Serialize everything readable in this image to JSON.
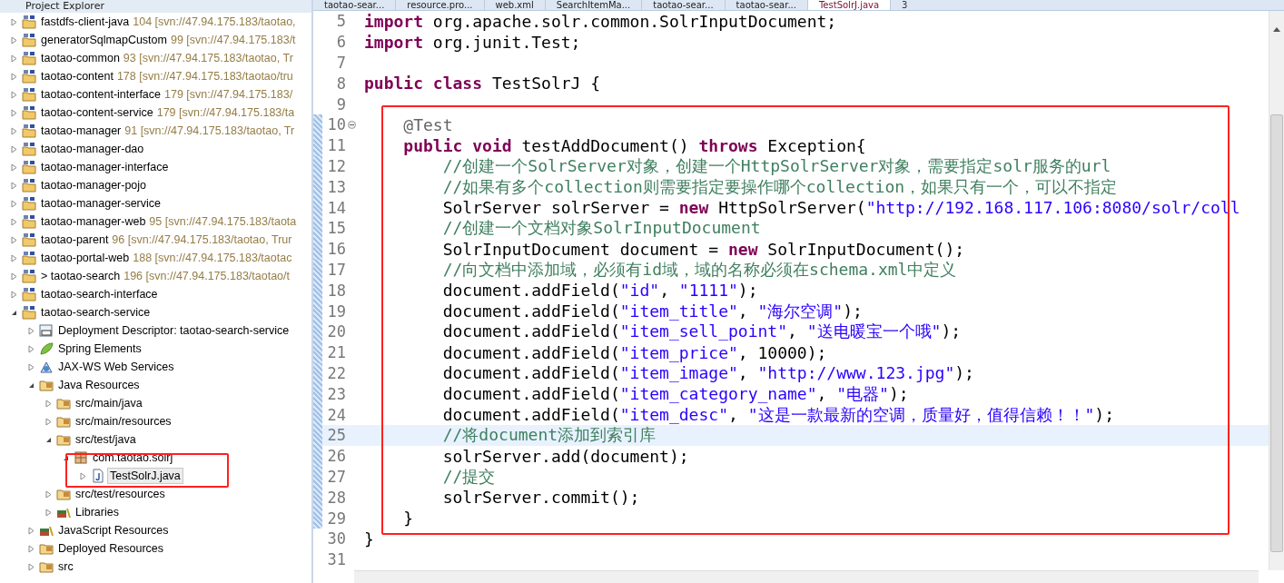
{
  "explorer": {
    "title": "Project Explorer",
    "tree": [
      {
        "label": "fastdfs-client-java",
        "decoration": "104 [svn://47.94.175.183/taotao,",
        "kind": "project",
        "expanded": false
      },
      {
        "label": "generatorSqlmapCustom",
        "decoration": "99 [svn://47.94.175.183/t",
        "kind": "project",
        "expanded": false
      },
      {
        "label": "taotao-common",
        "decoration": "93 [svn://47.94.175.183/taotao, Tr",
        "kind": "project",
        "expanded": false
      },
      {
        "label": "taotao-content",
        "decoration": "178 [svn://47.94.175.183/taotao/tru",
        "kind": "project",
        "expanded": false
      },
      {
        "label": "taotao-content-interface",
        "decoration": "179 [svn://47.94.175.183/",
        "kind": "project",
        "expanded": false
      },
      {
        "label": "taotao-content-service",
        "decoration": "179 [svn://47.94.175.183/ta",
        "kind": "project",
        "expanded": false
      },
      {
        "label": "taotao-manager",
        "decoration": "91 [svn://47.94.175.183/taotao, Tr",
        "kind": "project",
        "expanded": false
      },
      {
        "label": "taotao-manager-dao",
        "kind": "project",
        "expanded": false
      },
      {
        "label": "taotao-manager-interface",
        "kind": "project",
        "expanded": false
      },
      {
        "label": "taotao-manager-pojo",
        "kind": "project",
        "expanded": false
      },
      {
        "label": "taotao-manager-service",
        "kind": "project",
        "expanded": false
      },
      {
        "label": "taotao-manager-web",
        "decoration": "95 [svn://47.94.175.183/taota",
        "kind": "project",
        "expanded": false
      },
      {
        "label": "taotao-parent",
        "decoration": "96 [svn://47.94.175.183/taotao, Trur",
        "kind": "project",
        "expanded": false
      },
      {
        "label": "taotao-portal-web",
        "decoration": "188 [svn://47.94.175.183/taotac",
        "kind": "project",
        "expanded": false
      },
      {
        "label": "> taotao-search",
        "decoration": "196 [svn://47.94.175.183/taotao/t",
        "kind": "project",
        "expanded": false
      },
      {
        "label": "taotao-search-interface",
        "kind": "project",
        "expanded": false
      },
      {
        "label": "taotao-search-service",
        "kind": "project",
        "expanded": true,
        "children": [
          {
            "label": "Deployment Descriptor: taotao-search-service",
            "kind": "web",
            "expanded": false
          },
          {
            "label": "Spring Elements",
            "kind": "spring",
            "expanded": false
          },
          {
            "label": "JAX-WS Web Services",
            "kind": "ws",
            "expanded": false
          },
          {
            "label": "Java Resources",
            "kind": "folder",
            "expanded": true,
            "children": [
              {
                "label": "src/main/java",
                "kind": "folder",
                "expanded": false
              },
              {
                "label": "src/main/resources",
                "kind": "folder",
                "expanded": false
              },
              {
                "label": "src/test/java",
                "kind": "folder",
                "expanded": true,
                "children": [
                  {
                    "label": "com.taotao.solrj",
                    "kind": "package",
                    "expanded": true,
                    "children": [
                      {
                        "label": "TestSolrJ.java",
                        "kind": "java",
                        "expanded": false,
                        "selected": true
                      }
                    ]
                  }
                ]
              },
              {
                "label": "src/test/resources",
                "kind": "folder",
                "expanded": false
              },
              {
                "label": "Libraries",
                "kind": "library",
                "expanded": false
              }
            ]
          },
          {
            "label": "JavaScript Resources",
            "kind": "library",
            "expanded": false
          },
          {
            "label": "Deployed Resources",
            "kind": "folder",
            "expanded": false
          },
          {
            "label": "src",
            "kind": "folder",
            "expanded": false
          }
        ]
      }
    ]
  },
  "editor_tabs": [
    {
      "label": "taotao-sear...",
      "selected": false
    },
    {
      "label": "resource.pro...",
      "selected": false
    },
    {
      "label": "web.xml",
      "selected": false
    },
    {
      "label": "SearchItemMa...",
      "selected": false
    },
    {
      "label": "taotao-sear...",
      "selected": false
    },
    {
      "label": "taotao-sear...",
      "selected": false
    },
    {
      "label": "TestSolrJ.java",
      "selected": true
    }
  ],
  "overflow_count": "3",
  "code": [
    {
      "number": "5",
      "changed": false,
      "current": false,
      "tokens": [
        {
          "kind": "kw",
          "text": "import"
        },
        {
          "kind": "plain",
          "text": " org.apache.solr.common.SolrInputDocument;"
        }
      ]
    },
    {
      "number": "6",
      "changed": false,
      "current": false,
      "tokens": [
        {
          "kind": "kw",
          "text": "import"
        },
        {
          "kind": "plain",
          "text": " org.junit.Test;"
        }
      ]
    },
    {
      "number": "7",
      "changed": false,
      "current": false
    },
    {
      "number": "8",
      "changed": false,
      "current": false,
      "tokens": [
        {
          "kind": "kw",
          "text": "public class"
        },
        {
          "kind": "plain",
          "text": " TestSolrJ {"
        }
      ]
    },
    {
      "number": "9",
      "changed": false,
      "current": false
    },
    {
      "number": "10",
      "changed": true,
      "current": false,
      "folded": false,
      "tokens": [
        {
          "kind": "ann",
          "text": "    @Test"
        }
      ]
    },
    {
      "number": "11",
      "changed": true,
      "current": false,
      "tokens": [
        {
          "kind": "kw",
          "text": "    public void"
        },
        {
          "kind": "plain",
          "text": " testAddDocument() "
        },
        {
          "kind": "kw",
          "text": "throws"
        },
        {
          "kind": "plain",
          "text": " Exception{"
        }
      ]
    },
    {
      "number": "12",
      "changed": true,
      "current": false,
      "tokens": [
        {
          "kind": "cmt",
          "text": "        //创建一个SolrServer对象，创建一个HttpSolrServer对象，需要指定solr服务的url"
        }
      ]
    },
    {
      "number": "13",
      "changed": true,
      "current": false,
      "tokens": [
        {
          "kind": "cmt",
          "text": "        //如果有多个collection则需要指定要操作哪个collection，如果只有一个，可以不指定"
        }
      ]
    },
    {
      "number": "14",
      "changed": true,
      "current": false,
      "tokens": [
        {
          "kind": "plain",
          "text": "        SolrServer solrServer = "
        },
        {
          "kind": "kw",
          "text": "new"
        },
        {
          "kind": "plain",
          "text": " HttpSolrServer("
        },
        {
          "kind": "str",
          "text": "\"http://192.168.117.106:8080/solr/coll"
        }
      ]
    },
    {
      "number": "15",
      "changed": true,
      "current": false,
      "tokens": [
        {
          "kind": "cmt",
          "text": "        //创建一个文档对象SolrInputDocument"
        }
      ]
    },
    {
      "number": "16",
      "changed": true,
      "current": false,
      "tokens": [
        {
          "kind": "plain",
          "text": "        SolrInputDocument document = "
        },
        {
          "kind": "kw",
          "text": "new"
        },
        {
          "kind": "plain",
          "text": " SolrInputDocument();"
        }
      ]
    },
    {
      "number": "17",
      "changed": true,
      "current": false,
      "tokens": [
        {
          "kind": "cmt",
          "text": "        //向文档中添加域，必须有id域，域的名称必须在schema.xml中定义"
        }
      ]
    },
    {
      "number": "18",
      "changed": true,
      "current": false,
      "tokens": [
        {
          "kind": "plain",
          "text": "        document.addField("
        },
        {
          "kind": "str",
          "text": "\"id\""
        },
        {
          "kind": "plain",
          "text": ", "
        },
        {
          "kind": "str",
          "text": "\"1111\""
        },
        {
          "kind": "plain",
          "text": ");"
        }
      ]
    },
    {
      "number": "19",
      "changed": true,
      "current": false,
      "tokens": [
        {
          "kind": "plain",
          "text": "        document.addField("
        },
        {
          "kind": "str",
          "text": "\"item_title\""
        },
        {
          "kind": "plain",
          "text": ", "
        },
        {
          "kind": "str",
          "text": "\"海尔空调\""
        },
        {
          "kind": "plain",
          "text": ");"
        }
      ]
    },
    {
      "number": "20",
      "changed": true,
      "current": false,
      "tokens": [
        {
          "kind": "plain",
          "text": "        document.addField("
        },
        {
          "kind": "str",
          "text": "\"item_sell_point\""
        },
        {
          "kind": "plain",
          "text": ", "
        },
        {
          "kind": "str",
          "text": "\"送电暖宝一个哦\""
        },
        {
          "kind": "plain",
          "text": ");"
        }
      ]
    },
    {
      "number": "21",
      "changed": true,
      "current": false,
      "tokens": [
        {
          "kind": "plain",
          "text": "        document.addField("
        },
        {
          "kind": "str",
          "text": "\"item_price\""
        },
        {
          "kind": "plain",
          "text": ", 10000);"
        }
      ]
    },
    {
      "number": "22",
      "changed": true,
      "current": false,
      "tokens": [
        {
          "kind": "plain",
          "text": "        document.addField("
        },
        {
          "kind": "str",
          "text": "\"item_image\""
        },
        {
          "kind": "plain",
          "text": ", "
        },
        {
          "kind": "str",
          "text": "\"http://www.123.jpg\""
        },
        {
          "kind": "plain",
          "text": ");"
        }
      ]
    },
    {
      "number": "23",
      "changed": true,
      "current": false,
      "tokens": [
        {
          "kind": "plain",
          "text": "        document.addField("
        },
        {
          "kind": "str",
          "text": "\"item_category_name\""
        },
        {
          "kind": "plain",
          "text": ", "
        },
        {
          "kind": "str",
          "text": "\"电器\""
        },
        {
          "kind": "plain",
          "text": ");"
        }
      ]
    },
    {
      "number": "24",
      "changed": true,
      "current": false,
      "tokens": [
        {
          "kind": "plain",
          "text": "        document.addField("
        },
        {
          "kind": "str",
          "text": "\"item_desc\""
        },
        {
          "kind": "plain",
          "text": ", "
        },
        {
          "kind": "str",
          "text": "\"这是一款最新的空调，质量好，值得信赖！！\""
        },
        {
          "kind": "plain",
          "text": ");"
        }
      ]
    },
    {
      "number": "25",
      "changed": true,
      "current": true,
      "tokens": [
        {
          "kind": "cmt",
          "text": "        //将document添加到索引库"
        }
      ]
    },
    {
      "number": "26",
      "changed": true,
      "current": false,
      "tokens": [
        {
          "kind": "plain",
          "text": "        solrServer.add(document);"
        }
      ]
    },
    {
      "number": "27",
      "changed": true,
      "current": false,
      "tokens": [
        {
          "kind": "cmt",
          "text": "        //提交"
        }
      ]
    },
    {
      "number": "28",
      "changed": true,
      "current": false,
      "tokens": [
        {
          "kind": "plain",
          "text": "        solrServer.commit();"
        }
      ]
    },
    {
      "number": "29",
      "changed": true,
      "current": false,
      "tokens": [
        {
          "kind": "plain",
          "text": "    }"
        }
      ]
    },
    {
      "number": "30",
      "changed": false,
      "current": false,
      "tokens": [
        {
          "kind": "plain",
          "text": "}"
        }
      ]
    },
    {
      "number": "31",
      "changed": false,
      "current": false
    }
  ]
}
